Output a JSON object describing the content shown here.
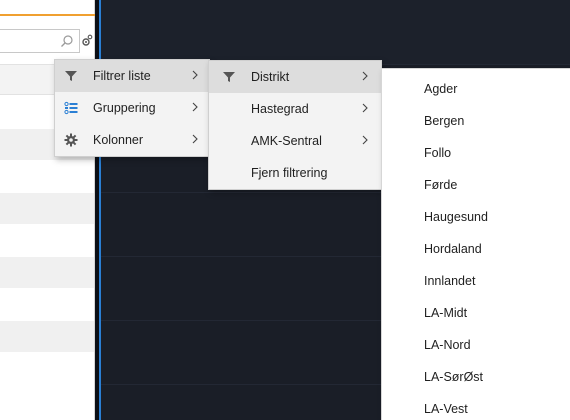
{
  "toolbar": {
    "search_icon": "search-icon",
    "settings_icon": "gear-icon"
  },
  "menu_level1": {
    "items": [
      {
        "label": "Filtrer liste",
        "icon": "filter-icon",
        "has_submenu": true,
        "active": true
      },
      {
        "label": "Gruppering",
        "icon": "list-group-icon",
        "has_submenu": true,
        "active": false
      },
      {
        "label": "Kolonner",
        "icon": "gear-icon",
        "has_submenu": true,
        "active": false
      }
    ]
  },
  "menu_level2": {
    "items": [
      {
        "label": "Distrikt",
        "icon": "filter-icon",
        "has_submenu": true,
        "active": true
      },
      {
        "label": "Hastegrad",
        "has_submenu": true,
        "active": false
      },
      {
        "label": "AMK-Sentral",
        "has_submenu": true,
        "active": false
      },
      {
        "label": "Fjern filtrering",
        "has_submenu": false,
        "active": false
      }
    ]
  },
  "menu_level3": {
    "items": [
      "Agder",
      "Bergen",
      "Follo",
      "Førde",
      "Haugesund",
      "Hordaland",
      "Innlandet",
      "LA-Midt",
      "LA-Nord",
      "LA-SørØst",
      "LA-Vest"
    ]
  },
  "colors": {
    "accent_orange": "#f0a030",
    "divider_blue": "#2a7fd4",
    "dark_background": "#1a1e27",
    "menu_background": "#f3f3f3",
    "menu_active": "#dddddd"
  }
}
